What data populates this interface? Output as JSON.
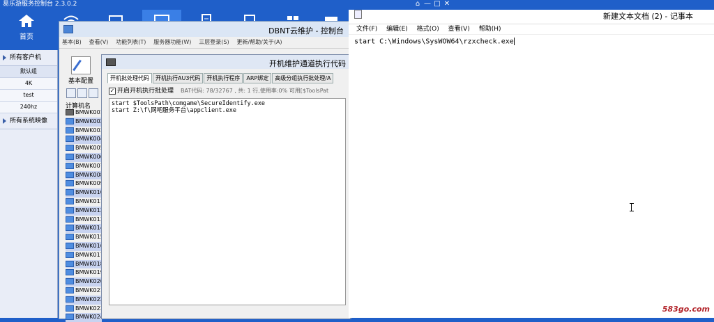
{
  "app": {
    "title": "易乐游服务控制台 2.3.0.2",
    "nav": [
      {
        "label": "首页",
        "icon": "home-icon",
        "active": false
      },
      {
        "label": "",
        "icon": "wifi-icon",
        "active": false
      },
      {
        "label": "",
        "icon": "card-icon",
        "active": false
      },
      {
        "label": "",
        "icon": "monitor-icon",
        "active": true
      },
      {
        "label": "",
        "icon": "document-icon",
        "active": false
      },
      {
        "label": "",
        "icon": "list-icon",
        "active": false
      },
      {
        "label": "",
        "icon": "grid-icon",
        "active": false
      },
      {
        "label": "",
        "icon": "folder-icon",
        "active": false
      }
    ]
  },
  "left_panel": {
    "clients_header": "所有客户机",
    "groups": [
      "默认组",
      "4K",
      "test",
      "240hz"
    ],
    "images_header": "所有系统映像"
  },
  "window_controls": [
    "⌂",
    "—",
    "□",
    "✕"
  ],
  "dbnt": {
    "title": "DBNT云维护 - 控制台",
    "menu": [
      "基本(B)",
      "查看(V)",
      "功能列表(T)",
      "服务器功能(W)",
      "三层登录(S)",
      "更新/帮助/关于(A)"
    ],
    "config_button": "基本配置",
    "computer_header": "计算机名",
    "computers": [
      "BMWK001",
      "BMWK002",
      "BMWK003",
      "BMWK004",
      "BMWK005",
      "BMWK006",
      "BMWK007",
      "BMWK008",
      "BMWK009",
      "BMWK010",
      "BMWK011",
      "BMWK012",
      "BMWK013",
      "BMWK014",
      "BMWK015",
      "BMWK016",
      "BMWK017",
      "BMWK018",
      "BMWK019",
      "BMWK020",
      "BMWK021",
      "BMWK022",
      "BMWK023",
      "BMWK024"
    ]
  },
  "child": {
    "title": "开机维护通道执行代码",
    "tabs": [
      "开机批处理代码",
      "开机执行AU3代码",
      "开机执行程序",
      "ARP绑定",
      "高级分组执行批处理/A"
    ],
    "checkbox_label": "开启开机执行批处理",
    "checkbox_checked": true,
    "bat_info": "BAT代码: 78/32767 , 共: 1 行,使用率:0% 可用[$ToolsPat",
    "code_lines": [
      "start $ToolsPath\\comgame\\SecureIdentify.exe",
      "start Z:\\f\\网吧服务平台\\appclient.exe"
    ]
  },
  "notepad": {
    "title": "新建文本文档 (2) - 记事本",
    "menu": [
      "文件(F)",
      "编辑(E)",
      "格式(O)",
      "查看(V)",
      "帮助(H)"
    ],
    "content": "start C:\\Windows\\SysWOW64\\rzxcheck.exe"
  },
  "watermark": "583go.com"
}
